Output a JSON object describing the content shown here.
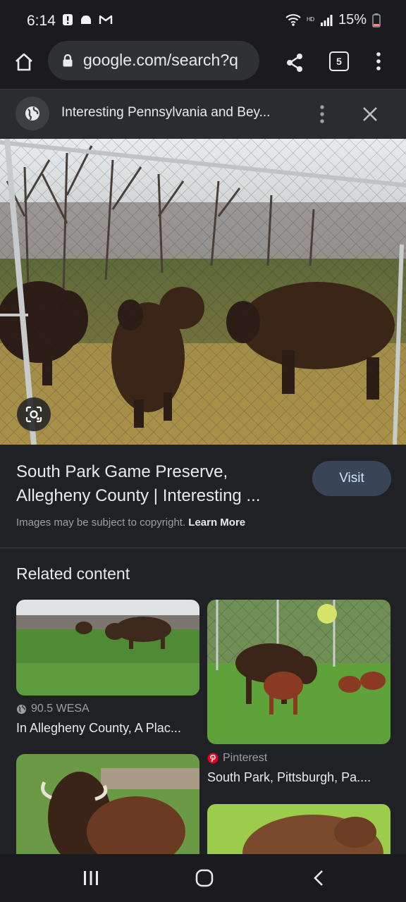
{
  "status_bar": {
    "time": "6:14",
    "battery": "15%",
    "network_label": "ᴴᴰ",
    "icons": [
      "alert-icon",
      "cloud-icon",
      "gmail-icon",
      "wifi-icon",
      "signal-icon",
      "battery-icon"
    ]
  },
  "browser": {
    "url": "google.com/search?q",
    "tab_count": "5"
  },
  "panel": {
    "title": "Interesting Pennsylvania and Bey..."
  },
  "result": {
    "title_line1": "South Park Game Preserve,",
    "title_line2": "Allegheny County | Interesting ...",
    "visit_label": "Visit",
    "copyright": "Images may be subject to copyright.",
    "learn_more": "Learn More"
  },
  "related": {
    "heading": "Related content",
    "items": [
      {
        "source": "90.5 WESA",
        "caption": "In Allegheny County, A Plac..."
      },
      {
        "source": "Pinterest",
        "caption": "South Park, Pittsburgh, Pa...."
      }
    ]
  },
  "colors": {
    "background": "#202124",
    "visit_button": "#394457",
    "pinterest": "#e60023"
  }
}
